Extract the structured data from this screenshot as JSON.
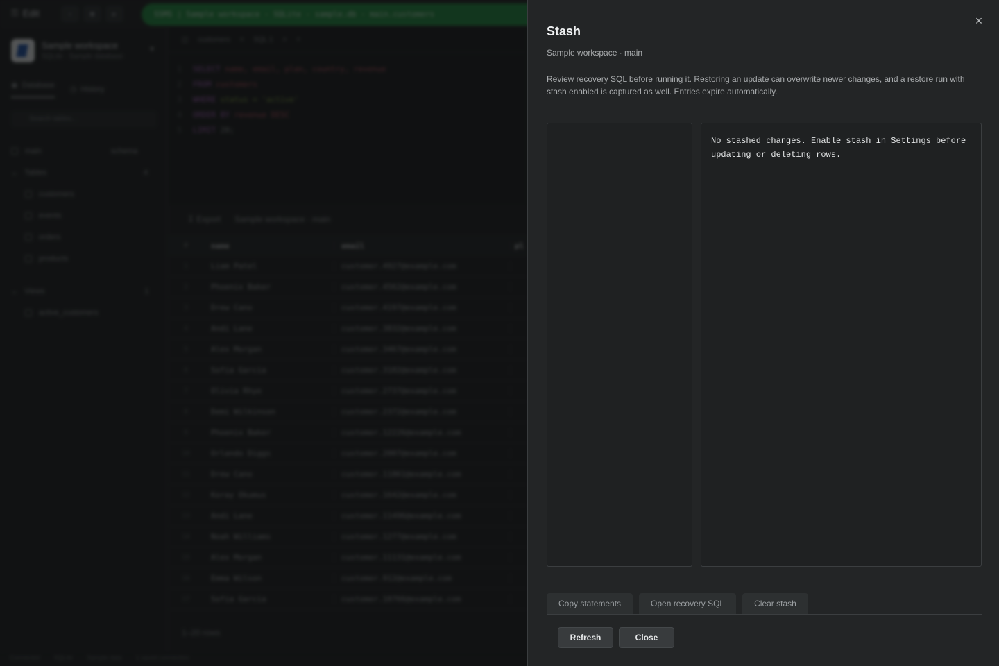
{
  "background": {
    "topbar": {
      "edit_label": "Edit",
      "connection": "SSMS | Sample workspace - SQLite - sample.db - main.customers"
    },
    "sidebar": {
      "workspace_name": "Sample workspace",
      "workspace_sub": "SQLite · Sample database",
      "tabs": [
        "Database",
        "History"
      ],
      "search_placeholder": "Search tables...",
      "schema": "main",
      "schema_hint": "schema",
      "tables_label": "Tables",
      "tables_count": "4",
      "tables": [
        "customers",
        "events",
        "orders",
        "products"
      ],
      "views_label": "Views",
      "views_count": "1",
      "views": [
        "active_customers"
      ]
    },
    "editor": {
      "tabs": [
        "customers",
        "SQL 1"
      ],
      "lines": [
        {
          "num": "1",
          "kw": "SELECT",
          "rest": "name, email, plan, country, revenue"
        },
        {
          "num": "2",
          "kw": "FROM",
          "rest": "customers"
        },
        {
          "num": "3",
          "kw": "WHERE",
          "rest": "status = 'active'"
        },
        {
          "num": "4",
          "kw": "ORDER BY",
          "rest": "revenue DESC"
        },
        {
          "num": "5",
          "kw": "LIMIT",
          "rest": "20;"
        }
      ]
    },
    "results": {
      "export_label": "Export",
      "context": "Sample workspace · main",
      "columns": [
        "#",
        "name",
        "email",
        "pl"
      ],
      "rows": [
        [
          "1",
          "Liam Patel",
          "customer.4927@example.com"
        ],
        [
          "2",
          "Phoenix Baker",
          "customer.4562@example.com"
        ],
        [
          "3",
          "Drew Cano",
          "customer.4197@example.com"
        ],
        [
          "4",
          "Andi Lane",
          "customer.3832@example.com"
        ],
        [
          "5",
          "Alex Morgan",
          "customer.3467@example.com"
        ],
        [
          "6",
          "Sofia Garcia",
          "customer.3102@example.com"
        ],
        [
          "7",
          "Olivia Rhye",
          "customer.2737@example.com"
        ],
        [
          "8",
          "Demi Wilkinson",
          "customer.2372@example.com"
        ],
        [
          "9",
          "Phoenix Baker",
          "customer.12226@example.com"
        ],
        [
          "10",
          "Orlando Diggs",
          "customer.2007@example.com"
        ],
        [
          "11",
          "Drew Cano",
          "customer.11861@example.com"
        ],
        [
          "12",
          "Koray Okumus",
          "customer.1642@example.com"
        ],
        [
          "13",
          "Andi Lane",
          "customer.11496@example.com"
        ],
        [
          "14",
          "Noah Williams",
          "customer.1277@example.com"
        ],
        [
          "15",
          "Alex Morgan",
          "customer.11131@example.com"
        ],
        [
          "16",
          "Emma Wilson",
          "customer.912@example.com"
        ],
        [
          "17",
          "Sofia Garcia",
          "customer.10766@example.com"
        ]
      ],
      "row_count": "1–20 rows"
    },
    "status": [
      "Connected",
      "SQLite",
      "Sample data",
      "1 saved connection"
    ]
  },
  "panel": {
    "title": "Stash",
    "subtitle": "Sample workspace · main",
    "description": "Review recovery SQL before running it. Restoring an update can overwrite newer changes, and a restore run with stash enabled is captured as well. Entries expire automatically.",
    "empty_message": "No stashed changes. Enable stash in Settings before updating or deleting rows.",
    "actions": {
      "copy": "Copy statements",
      "open": "Open recovery SQL",
      "clear": "Clear stash"
    },
    "footer": {
      "refresh": "Refresh",
      "close": "Close"
    },
    "close_icon": "×"
  }
}
